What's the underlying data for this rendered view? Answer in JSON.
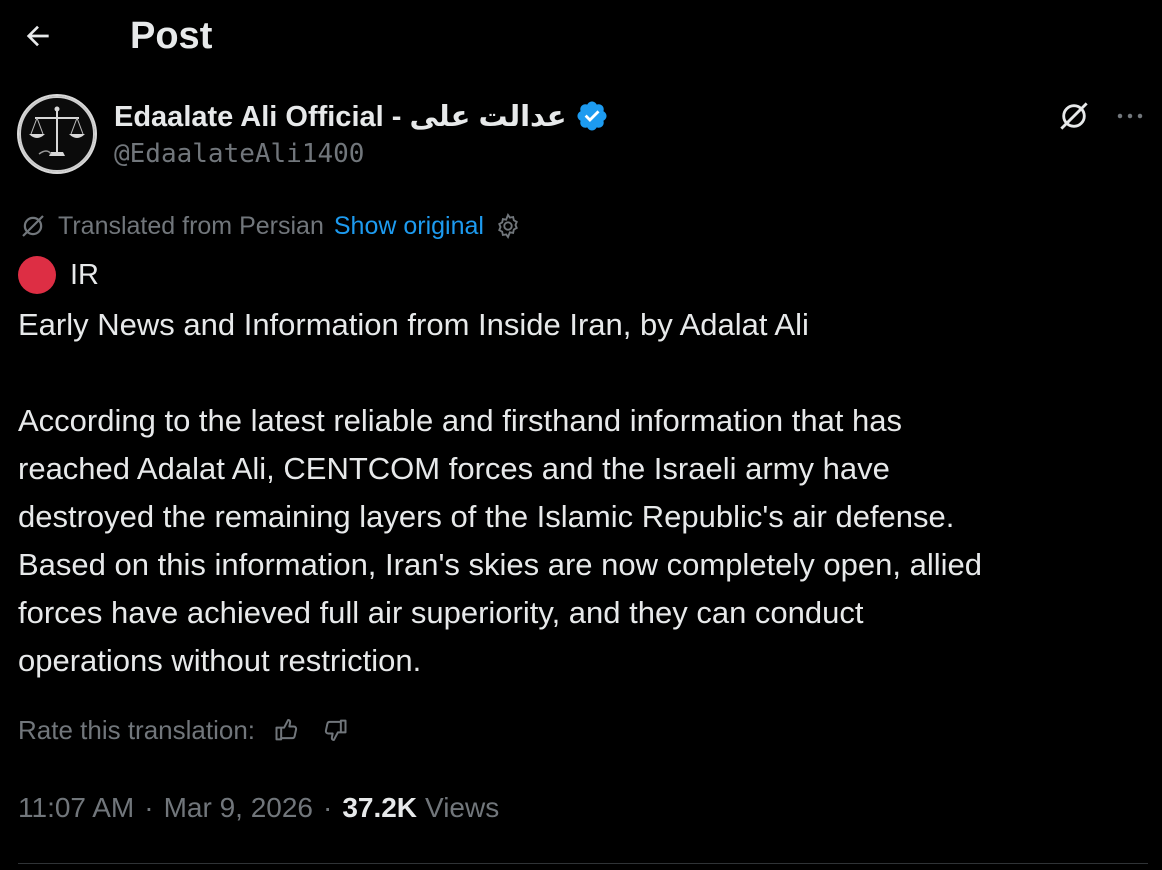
{
  "header": {
    "back_icon": "arrow-left-icon",
    "title": "Post"
  },
  "author": {
    "avatar_icon": "scales-of-justice-icon",
    "display_name": "Edaalate Ali Official - عدالت علی",
    "verified_icon": "verified-badge-icon",
    "verified_color": "#1d9bf0",
    "handle": "@EdaalateAli1400"
  },
  "actions": {
    "grok_icon": "grok-icon",
    "more_icon": "more-dots-icon"
  },
  "translation": {
    "icon": "grok-translate-icon",
    "label": "Translated from Persian",
    "show_original": "Show original",
    "settings_icon": "gear-icon",
    "link_color": "#1d9bf0"
  },
  "post": {
    "tag": "IR",
    "tag_dot_color": "#dd2e44",
    "line1": "Early News and Information from Inside Iran, by Adalat Ali",
    "body_lines": [
      "According to the latest reliable and firsthand information that has",
      "reached Adalat Ali, CENTCOM forces and the Israeli army have",
      "destroyed the remaining layers of the Islamic Republic's air defense.",
      "Based on this information, Iran's skies are now completely open, allied",
      "forces have achieved full air superiority, and they can conduct",
      "operations without restriction."
    ]
  },
  "rating": {
    "label": "Rate this translation:",
    "thumbs_up_icon": "thumbs-up-icon",
    "thumbs_down_icon": "thumbs-down-icon"
  },
  "meta": {
    "time": "11:07 AM",
    "separator": "·",
    "date": "Mar 9, 2026",
    "views_count": "37.2K",
    "views_label": "Views"
  },
  "colors": {
    "background": "#000000",
    "text_primary": "#e7e9ea",
    "text_secondary": "#71767b",
    "divider": "#2f3336"
  }
}
